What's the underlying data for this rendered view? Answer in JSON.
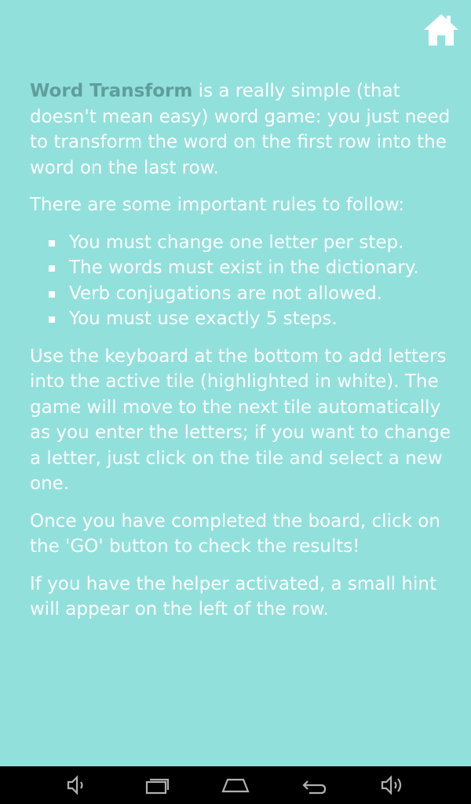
{
  "help": {
    "intro_brand": "Word Transform",
    "intro_text": " is a really simple (that doesn't mean easy) word game: you just need to transform the word on the first row into the word on the last row.",
    "rules_intro": "There are some important rules to follow:",
    "rules": [
      "You must change one letter per step.",
      "The words must exist in the dictionary.",
      "Verb conjugations are not allowed.",
      "You must use exactly 5 steps."
    ],
    "keyboard_text": "Use the keyboard at the bottom to add letters into the active tile (highlighted in white). The game will move to the next tile automatically as you enter the letters; if you want to change a letter, just click on the tile and select a new one.",
    "go_text": "Once you have completed the board, click on the 'GO' button to check the results!",
    "helper_text": "If you have the helper activated, a small hint will appear on the left of the row."
  },
  "colors": {
    "background": "#92e0dc",
    "text": "#ffffff",
    "brand": "#5f9e9b",
    "navbar": "#000000"
  },
  "icons": {
    "home": "home-icon",
    "nav": [
      "volume-down-icon",
      "recent-apps-icon",
      "home-icon",
      "back-icon",
      "volume-up-icon"
    ]
  }
}
